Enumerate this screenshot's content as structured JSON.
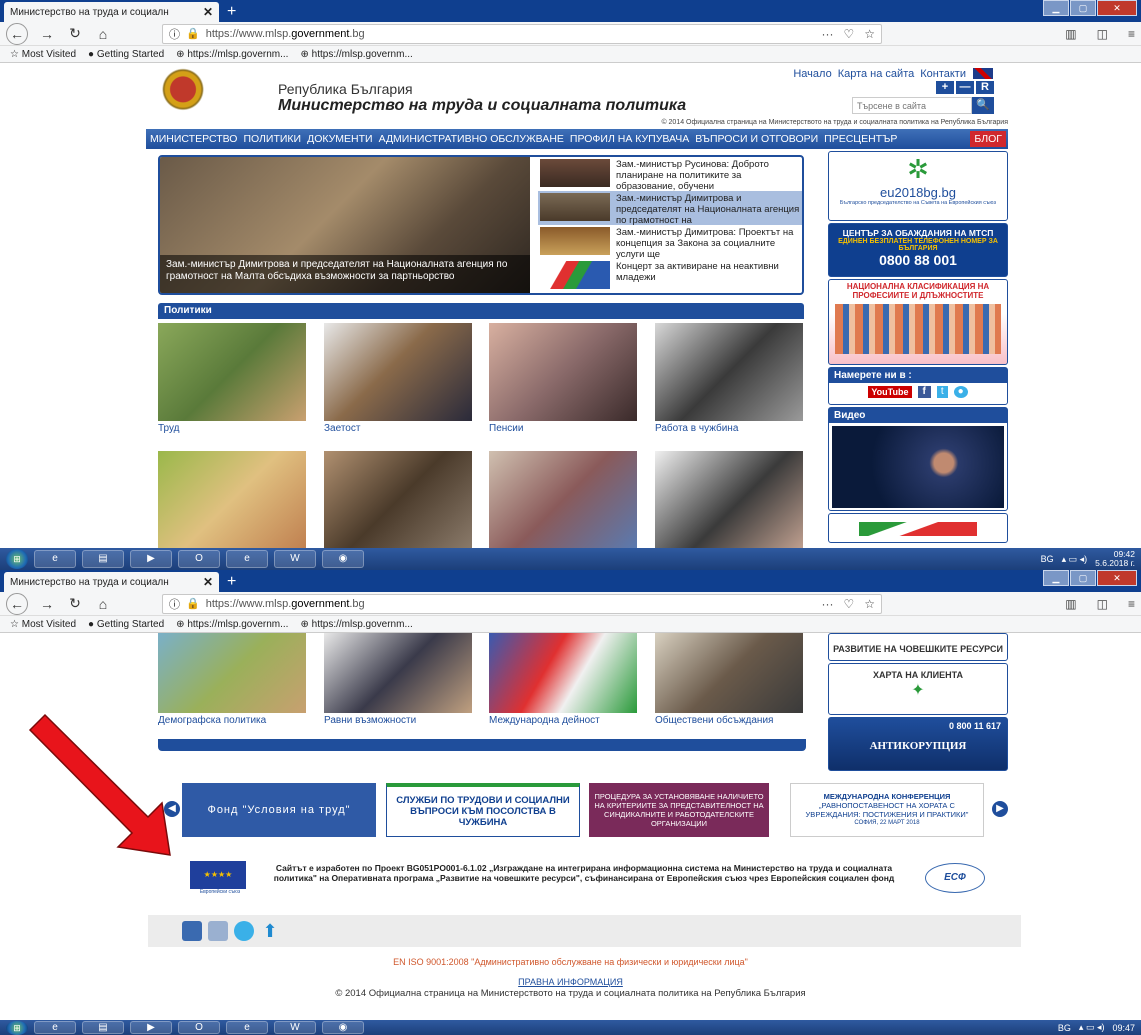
{
  "browser": {
    "tab_title": "Министерство на труда и социалн",
    "tab_close": "✕",
    "new_tab": "+",
    "url_prefix": "https://www.mlsp.",
    "url_domain": "government",
    "url_suffix": ".bg",
    "url_menu": "···",
    "bookmarks": [
      "Most Visited",
      "Getting Started",
      "https://mlsp.governm...",
      "https://mlsp.governm..."
    ]
  },
  "header": {
    "republic": "Република България",
    "ministry": "Министерство на труда и социалната политика",
    "toplinks": [
      "Начало",
      "Карта на сайта",
      "Контакти"
    ],
    "size_buttons": [
      "+",
      "—",
      "R"
    ],
    "search_placeholder": "Търсене в сайта",
    "copyright": "© 2014 Официална страница на Министерството на труда и социалната политика на Република България"
  },
  "menu": [
    "МИНИСТЕРСТВО",
    "ПОЛИТИКИ",
    "ДОКУМЕНТИ",
    "АДМИНИСТРАТИВНО ОБСЛУЖВАНЕ",
    "ПРОФИЛ НА КУПУВАЧА",
    "ВЪПРОСИ И ОТГОВОРИ",
    "ПРЕСЦЕНТЪР",
    "БЛОГ"
  ],
  "slider": {
    "caption": "Зам.-министър Димитрова и председателят на Националната агенция по грамотност на Малта обсъдиха възможности за партньорство",
    "news": [
      "Зам.-министър Русинова: Доброто планиране на политиките за образование, обучени",
      "Зам.-министър Димитрова и председателят на Националната агенция по грамотност на",
      "Зам.-министър Димитрова: Проектът на концепция за Закона за социалните услуги ще",
      "Концерт за активиране на неактивни младежи"
    ]
  },
  "policies": {
    "title": "Политики",
    "row1": [
      "Труд",
      "Заетост",
      "Пенсии",
      "Работа в чужбина"
    ],
    "row2": [
      "Демографска политика",
      "Равни възможности",
      "Международна дейност",
      "Обществени обсъждания"
    ]
  },
  "sidebar": {
    "eu_label": "eu2018bg.bg",
    "eu_sub": "Българско председателство на Съвета на Европейския съюз",
    "call_title": "ЦЕНТЪР ЗА ОБАЖДАНИЯ НА МТСП",
    "call_sub": "ЕДИНЕН БЕЗПЛАТЕН ТЕЛЕФОНЕН НОМЕР ЗА БЪЛГАРИЯ",
    "call_number": "0800 88 001",
    "class_title": "НАЦИОНАЛНА КЛАСИФИКАЦИЯ НА ПРОФЕСИИТЕ И ДЛЪЖНОСТИТЕ",
    "find_us": "Намерете ни в :",
    "youtube": "YouTube",
    "video": "Видео",
    "hr_label": "РАЗВИТИЕ НА ЧОВЕШКИТЕ РЕСУРСИ",
    "charter": "ХАРТА НА КЛИЕНТА",
    "anti_phone": "0 800 11 617",
    "anti": "АНТИКОРУПЦИЯ"
  },
  "banners": {
    "fund": "Фонд \"Условия на труд\"",
    "services": "СЛУЖБИ ПО ТРУДОВИ И СОЦИАЛНИ ВЪПРОСИ КЪМ ПОСОЛСТВА В ЧУЖБИНА",
    "procedure": "ПРОЦЕДУРА ЗА УСТАНОВЯВАНЕ НАЛИЧИЕТО НА КРИТЕРИИТЕ ЗА ПРЕДСТАВИТЕЛНОСТ НА СИНДИКАЛНИТЕ И РАБОТОДАТЕЛСКИТЕ ОРГАНИЗАЦИИ",
    "conference_title": "МЕЖДУНАРОДНА КОНФЕРЕНЦИЯ",
    "conference_text": "„РАВНОПОСТАВЕНОСТ НА ХОРАТА С УВРЕЖДАНИЯ: ПОСТИЖЕНИЯ И ПРАКТИКИ\"",
    "conference_date": "СОФИЯ, 22 МАРТ 2018"
  },
  "footer": {
    "project": "Сайтът е изработен по Проект BG051PO001-6.1.02 „Изграждане на интегрирана информационна система на Министерство на труда и социалната политика\" на Оперативната програма „Развитие на човешките ресурси\", съфинансирана от Европейския съюз чрез Европейския социален фонд",
    "eu": "Европейски съюз",
    "esf": "ЕСФ",
    "iso": "EN ISO 9001:2008 \"Административно обслужване на физически и юридически лица\"",
    "legal": "ПРАВНА ИНФОРМАЦИЯ",
    "copyright": "© 2014 Официална страница на Министерството на труда и социалната политика на Република България"
  },
  "taskbar": {
    "lang": "BG",
    "time1": "09:42",
    "date1": "5.6.2018 г.",
    "time2": "09:47"
  },
  "colors": {
    "accent": "#1f4e9c",
    "blog": "#d0282d",
    "arrow": "#e8141b",
    "tab_bar": "#0f3f8f"
  }
}
